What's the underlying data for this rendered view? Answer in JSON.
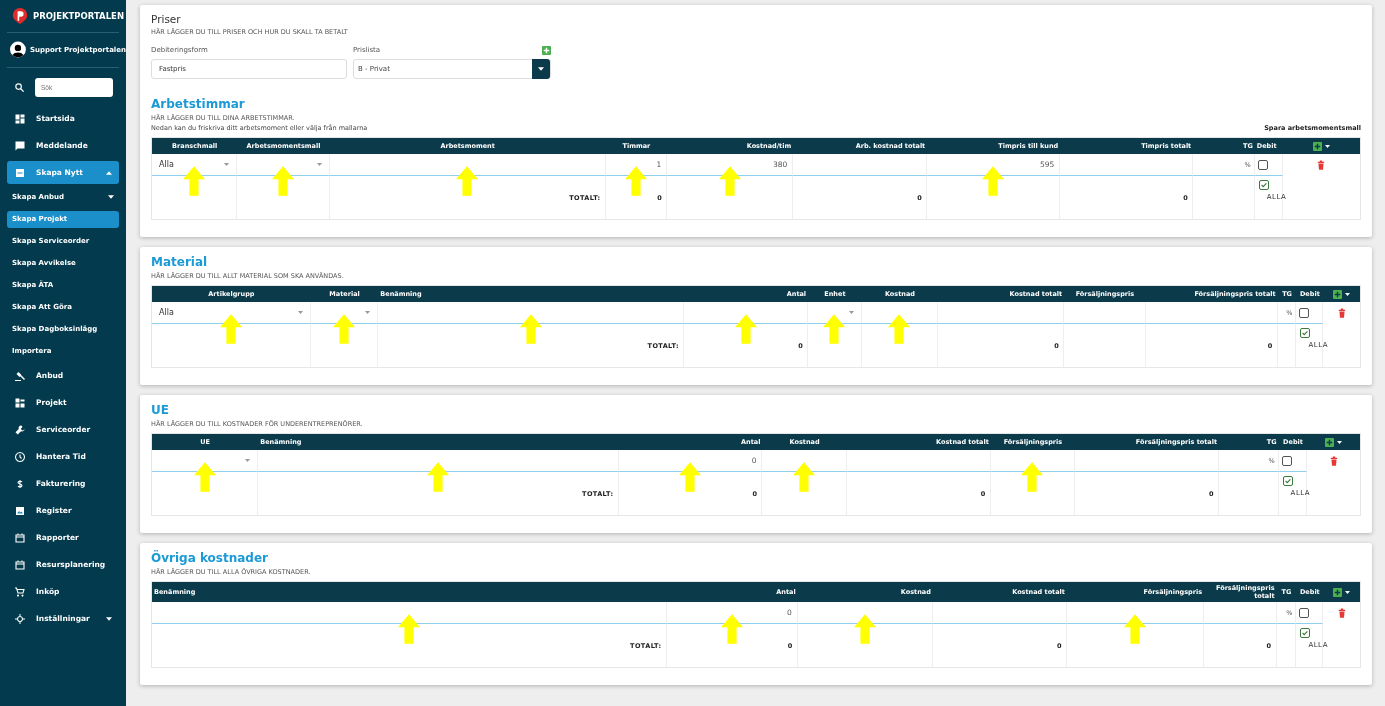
{
  "sidebar": {
    "brand": "PROJEKTPORTALEN",
    "user": "Support Projektportalen",
    "search": {
      "placeholder": "Sök"
    },
    "items": [
      {
        "label": "Startsida",
        "selected": false
      },
      {
        "label": "Meddelande",
        "selected": false
      },
      {
        "label": "Skapa Nytt",
        "selected": true,
        "expanded": true,
        "children": [
          {
            "label": "Skapa Anbud",
            "selected": false,
            "expanded": false
          },
          {
            "label": "Skapa Projekt",
            "selected": true
          },
          {
            "label": "Skapa Serviceorder",
            "selected": false
          },
          {
            "label": "Skapa Avvikelse",
            "selected": false
          },
          {
            "label": "Skapa ÄTA",
            "selected": false
          },
          {
            "label": "Skapa Att Göra",
            "selected": false
          },
          {
            "label": "Skapa Dagboksinlägg",
            "selected": false
          },
          {
            "label": "Importera",
            "selected": false
          }
        ]
      },
      {
        "label": "Anbud",
        "selected": false
      },
      {
        "label": "Projekt",
        "selected": false
      },
      {
        "label": "Serviceorder",
        "selected": false
      },
      {
        "label": "Hantera Tid",
        "selected": false
      },
      {
        "label": "Fakturering",
        "selected": false
      },
      {
        "label": "Register",
        "selected": false
      },
      {
        "label": "Rapporter",
        "selected": false
      },
      {
        "label": "Resursplanering",
        "selected": false
      },
      {
        "label": "Inköp",
        "selected": false
      },
      {
        "label": "Inställningar",
        "selected": false,
        "expanded": false
      }
    ]
  },
  "priser": {
    "title": "Priser",
    "subtitle": "HÄR LÄGGER DU TILL PRISER OCH HUR DU SKALL TA BETALT",
    "fields": [
      {
        "label": "Debiteringsform",
        "kind": "text",
        "value": "Fastpris"
      },
      {
        "label": "Prislista",
        "kind": "select",
        "value": "B - Privat"
      }
    ]
  },
  "sections": [
    {
      "title": "Arbetstimmar",
      "subtitle": "HÄR LÄGGER DU TILL DINA ARBETSTIMMAR.",
      "note": "Nedan kan du friskriva ditt arbetsmoment eller välja från mallarna",
      "link": "Spara arbetsmomentsmall",
      "columns": [
        {
          "label": "Branschmall",
          "kind": "select",
          "value": "Alla",
          "arrow": true
        },
        {
          "label": "Arbetsmomentsmall",
          "kind": "select",
          "arrow": true
        },
        {
          "label": "Arbetsmoment",
          "kind": "text",
          "arrow": true,
          "total": "TOTALT:"
        },
        {
          "label": "Timmar",
          "kind": "number",
          "value": "1",
          "arrow": true,
          "total": "0"
        },
        {
          "label": "Kostnad/tim",
          "kind": "number",
          "value": "380",
          "arrow": true
        },
        {
          "label": "Arb. kostnad totalt",
          "kind": "number",
          "total": "0"
        },
        {
          "label": "Timpris till kund",
          "kind": "number",
          "value": "595",
          "arrow": true
        },
        {
          "label": "Timpris totalt",
          "kind": "number",
          "total": "0"
        },
        {
          "label": "TG",
          "kind": "tg",
          "value": "%"
        },
        {
          "label": "Debit",
          "kind": "debit",
          "checked": false,
          "all_checked": true,
          "total": "ALLA"
        },
        {
          "kind": "actions"
        }
      ]
    },
    {
      "title": "Material",
      "subtitle": "HÄR LÄGGER DU TILL ALLT MATERIAL SOM SKA ANVÄNDAS.",
      "columns": [
        {
          "label": "Artikelgrupp",
          "kind": "select",
          "value": "Alla",
          "arrow": true
        },
        {
          "label": "Material",
          "kind": "select",
          "arrow": true
        },
        {
          "label": "Benämning",
          "kind": "text",
          "arrow": true,
          "total": "TOTALT:"
        },
        {
          "label": "Antal",
          "kind": "number",
          "arrow": true,
          "total": "0"
        },
        {
          "label": "Enhet",
          "kind": "select",
          "arrow": true
        },
        {
          "label": "Kostnad",
          "kind": "number",
          "arrow": true
        },
        {
          "label": "Kostnad totalt",
          "kind": "number",
          "total": "0"
        },
        {
          "label": "Försäljningspris",
          "kind": "number"
        },
        {
          "label": "Försäljningspris totalt",
          "kind": "number",
          "total": "0"
        },
        {
          "label": "TG",
          "kind": "tg",
          "value": "%"
        },
        {
          "label": "Debit",
          "kind": "debit",
          "checked": false,
          "all_checked": true,
          "total": "ALLA"
        },
        {
          "kind": "actions"
        }
      ]
    },
    {
      "title": "UE",
      "subtitle": "HÄR LÄGGER DU TILL KOSTNADER FÖR UNDERENTREPRENÖRER.",
      "columns": [
        {
          "label": "UE",
          "kind": "select",
          "arrow": true
        },
        {
          "label": "Benämning",
          "kind": "text",
          "arrow": true,
          "total": "TOTALT:"
        },
        {
          "label": "Antal",
          "kind": "number",
          "value": "0",
          "arrow": true,
          "total": "0"
        },
        {
          "label": "Kostnad",
          "kind": "number",
          "arrow": true
        },
        {
          "label": "Kostnad totalt",
          "kind": "number",
          "total": "0"
        },
        {
          "label": "Försäljningspris",
          "kind": "number",
          "arrow": true
        },
        {
          "label": "Försäljningspris totalt",
          "kind": "number",
          "total": "0"
        },
        {
          "label": "TG",
          "kind": "tg",
          "value": "%"
        },
        {
          "label": "Debit",
          "kind": "debit",
          "checked": false,
          "all_checked": true,
          "total": "ALLA"
        },
        {
          "kind": "actions"
        }
      ]
    },
    {
      "title": "Övriga kostnader",
      "subtitle": "HÄR LÄGGER DU TILL ALLA ÖVRIGA KOSTNADER.",
      "columns": [
        {
          "label": "Benämning",
          "kind": "text",
          "arrow": true,
          "total": "TOTALT:"
        },
        {
          "label": "Antal",
          "kind": "number",
          "value": "0",
          "arrow": true,
          "total": "0"
        },
        {
          "label": "Kostnad",
          "kind": "number",
          "arrow": true
        },
        {
          "label": "Kostnad totalt",
          "kind": "number",
          "total": "0"
        },
        {
          "label": "Försäljningspris",
          "kind": "number",
          "arrow": true
        },
        {
          "label": "Försäljningspris totalt",
          "kind": "number",
          "total": "0"
        },
        {
          "label": "TG",
          "kind": "tg",
          "value": "%"
        },
        {
          "label": "Debit",
          "kind": "debit",
          "checked": false,
          "all_checked": true,
          "total": "ALLA"
        },
        {
          "kind": "actions"
        }
      ]
    }
  ]
}
